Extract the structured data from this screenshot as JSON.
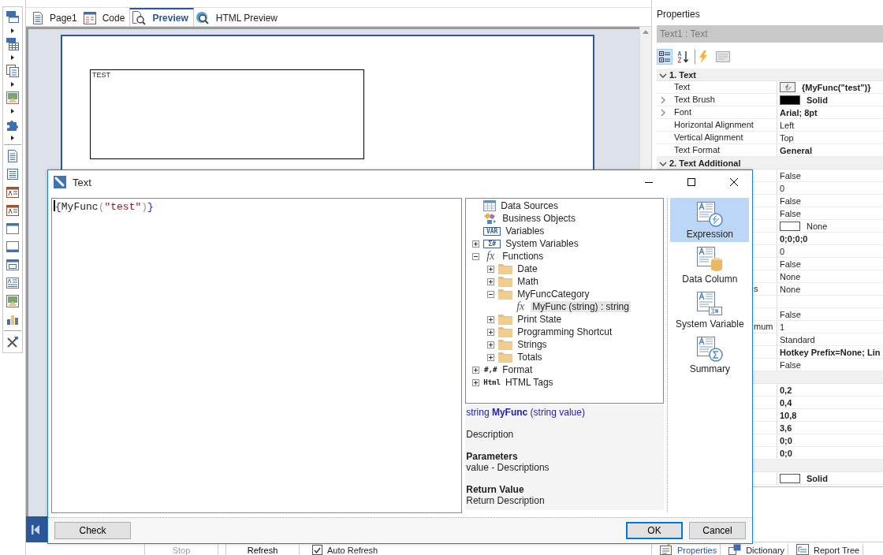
{
  "tabs": [
    {
      "label": "Page1",
      "selected": false
    },
    {
      "label": "Code",
      "selected": false
    },
    {
      "label": "Preview",
      "selected": true
    },
    {
      "label": "HTML Preview",
      "selected": false
    }
  ],
  "preview": {
    "component_text": "TEST"
  },
  "preview_toolbar": {
    "buttons": [
      {
        "label": "Stop",
        "disabled": true
      },
      {
        "label": "Refresh",
        "disabled": false
      }
    ],
    "auto_refresh": {
      "label": "Auto Refresh",
      "checked": true
    }
  },
  "properties": {
    "title": "Properties",
    "object": "Text1 : Text",
    "view_buttons": [
      {
        "kind": "categorized",
        "selected": true
      },
      {
        "kind": "alphabetical",
        "selected": false
      }
    ],
    "sections": [
      {
        "title": "1. Text",
        "expanded": true,
        "rows": [
          {
            "name": "Text",
            "value": "{MyFunc(\"test\")}",
            "bold": true,
            "kind": "expression",
            "expandable": false
          },
          {
            "name": "Text Brush",
            "value": "Solid",
            "bold": true,
            "kind": "brush",
            "color": "#000000",
            "expandable": true
          },
          {
            "name": "Font",
            "value": "Arial; 8pt",
            "bold": true,
            "kind": "plain",
            "expandable": true
          },
          {
            "name": "Horizontal Alignment",
            "value": "Left",
            "bold": false,
            "kind": "plain",
            "expandable": false
          },
          {
            "name": "Vertical Alignment",
            "value": "Top",
            "bold": false,
            "kind": "plain",
            "expandable": false
          },
          {
            "name": "Text Format",
            "value": "General",
            "bold": true,
            "kind": "plain",
            "expandable": false
          }
        ]
      },
      {
        "title": "2. Text  Additional",
        "expanded": true,
        "rows": [
          {
            "value": "False",
            "bold": false,
            "kind": "plain"
          },
          {
            "value": "0",
            "bold": false,
            "kind": "plain"
          },
          {
            "value": "False",
            "bold": false,
            "kind": "plain"
          },
          {
            "value": "False",
            "bold": false,
            "kind": "plain"
          },
          {
            "value": "None",
            "bold": false,
            "kind": "brush",
            "color": "#ffffff"
          },
          {
            "value": "0;0;0;0",
            "bold": true,
            "kind": "plain"
          },
          {
            "value": "0",
            "bold": false,
            "kind": "plain"
          },
          {
            "value": "False",
            "bold": false,
            "kind": "plain"
          },
          {
            "value": "None",
            "bold": false,
            "kind": "plain"
          },
          {
            "name": "s",
            "value": "None",
            "bold": false,
            "kind": "plain"
          },
          {
            "kind": "plain"
          },
          {
            "value": "False",
            "bold": false,
            "kind": "plain"
          },
          {
            "name": "mum",
            "value": "1",
            "bold": false,
            "kind": "plain"
          },
          {
            "value": "Standard",
            "bold": false,
            "kind": "plain"
          },
          {
            "value": "Hotkey Prefix=None; Lin",
            "bold": true,
            "kind": "plain"
          },
          {
            "value": "False",
            "bold": false,
            "kind": "plain"
          }
        ]
      },
      {
        "rows": [
          {
            "value": "0,2",
            "bold": true,
            "kind": "plain"
          },
          {
            "value": "0,4",
            "bold": true,
            "kind": "plain"
          },
          {
            "value": "10,8",
            "bold": true,
            "kind": "plain"
          },
          {
            "value": "3,6",
            "bold": true,
            "kind": "plain"
          },
          {
            "value": "0;0",
            "bold": true,
            "kind": "plain"
          },
          {
            "value": "0;0",
            "bold": true,
            "kind": "plain"
          }
        ]
      },
      {
        "rows": [
          {
            "value": "Solid",
            "bold": true,
            "kind": "brush",
            "color": "#ffffff"
          }
        ]
      }
    ]
  },
  "bottom_tabs": [
    {
      "label": "Properties",
      "selected": true
    },
    {
      "label": "Dictionary",
      "selected": false
    },
    {
      "label": "Report Tree",
      "selected": false
    }
  ],
  "dialog": {
    "title": "Text",
    "expression": [
      {
        "text": "{",
        "kind": "brace"
      },
      {
        "text": "MyFunc",
        "kind": "name"
      },
      {
        "text": "(",
        "kind": "paren"
      },
      {
        "text": "\"test\"",
        "kind": "string"
      },
      {
        "text": ")",
        "kind": "paren"
      },
      {
        "text": "}",
        "kind": "brace"
      }
    ],
    "tree": [
      {
        "label": "Data Sources",
        "kind": "table",
        "selected": false
      },
      {
        "label": "Business Objects",
        "kind": "objects",
        "selected": false
      },
      {
        "label": "Variables",
        "kind": "code",
        "badge": "VAR",
        "selected": false
      },
      {
        "label": "System Variables",
        "kind": "code",
        "badge": "Σ#",
        "expanded": false,
        "selected": false
      },
      {
        "label": "Functions",
        "kind": "function",
        "badge": "fx",
        "expanded": true,
        "selected": false,
        "children": [
          {
            "label": "Date",
            "kind": "folder",
            "expanded": false,
            "selected": false
          },
          {
            "label": "Math",
            "kind": "folder",
            "expanded": false,
            "selected": false
          },
          {
            "label": "MyFuncCategory",
            "kind": "folder",
            "expanded": true,
            "selected": false,
            "children": [
              {
                "label": "MyFunc (string) : string",
                "kind": "function",
                "badge": "fx",
                "selected": true
              }
            ]
          },
          {
            "label": "Print State",
            "kind": "folder",
            "expanded": false,
            "selected": false
          },
          {
            "label": "Programming Shortcut",
            "kind": "folder",
            "expanded": false,
            "selected": false
          },
          {
            "label": "Strings",
            "kind": "folder",
            "expanded": false,
            "selected": false
          },
          {
            "label": "Totals",
            "kind": "folder",
            "expanded": false,
            "selected": false
          }
        ]
      },
      {
        "label": "Format",
        "kind": "plain",
        "badge": "#,#",
        "expanded": false,
        "selected": false
      },
      {
        "label": "HTML Tags",
        "kind": "plain",
        "badge": "Html",
        "expanded": false,
        "selected": false
      }
    ],
    "info": {
      "signature": "string  **MyFunc** (string value)",
      "description": "Description",
      "parameters_title": "Parameters",
      "parameters": "value - Descriptions",
      "return_title": "Return Value",
      "return": "Return Description"
    },
    "modes": [
      {
        "label": "Expression",
        "selected": true
      },
      {
        "label": "Data Column",
        "selected": false
      },
      {
        "label": "System Variable",
        "selected": false
      },
      {
        "label": "Summary",
        "selected": false
      }
    ],
    "buttons": {
      "check": "Check",
      "ok": "OK",
      "cancel": "Cancel"
    }
  }
}
